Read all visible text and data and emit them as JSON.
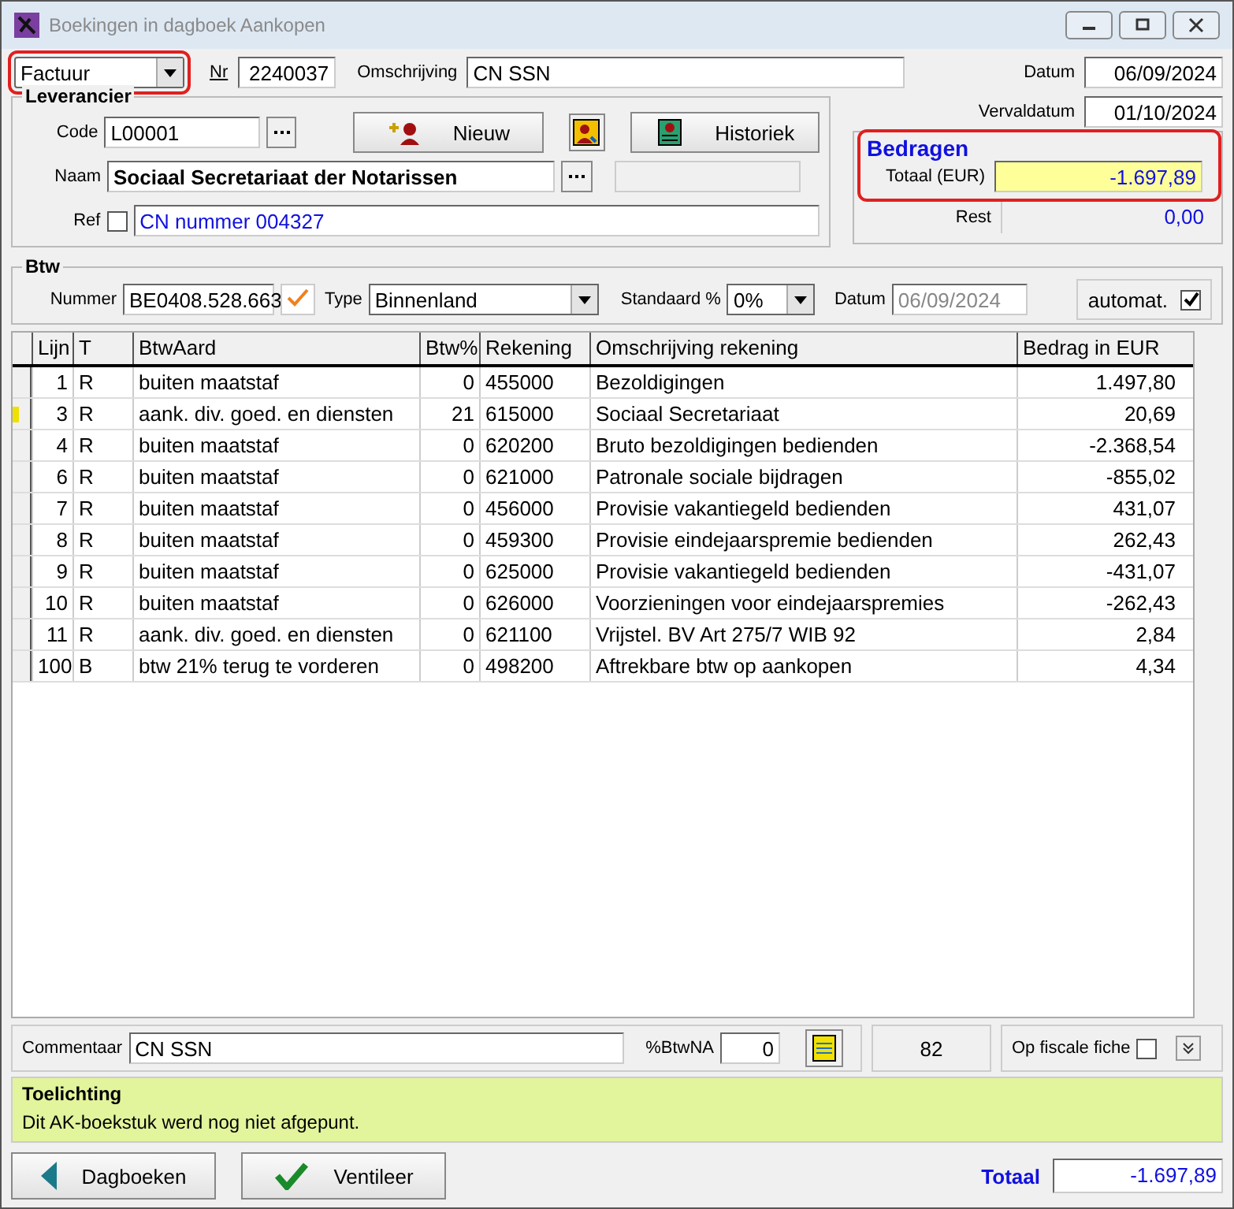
{
  "window": {
    "title": "Boekingen in dagboek Aankopen"
  },
  "header": {
    "doc_type": {
      "value": "Factuur",
      "highlighted": true
    },
    "nr_label": "Nr",
    "nr": "2240037",
    "omschrijving_label": "Omschrijving",
    "omschrijving": "CN SSN",
    "datum_label": "Datum",
    "datum": "06/09/2024",
    "vervaldatum_label": "Vervaldatum",
    "vervaldatum": "01/10/2024"
  },
  "leverancier": {
    "title": "Leverancier",
    "code_label": "Code",
    "code": "L00001",
    "nieuw_button": "Nieuw",
    "historiek_button": "Historiek",
    "naam_label": "Naam",
    "naam": "Sociaal Secretariaat der Notarissen",
    "ref_label": "Ref",
    "ref_checked": false,
    "ref": "CN nummer 004327"
  },
  "bedragen": {
    "title": "Bedragen",
    "totaal_label": "Totaal (EUR)",
    "totaal": "-1.697,89",
    "highlighted": true,
    "rest_label": "Rest",
    "rest": "0,00"
  },
  "btw": {
    "title": "Btw",
    "nummer_label": "Nummer",
    "nummer": "BE0408.528.663",
    "type_label": "Type",
    "type": "Binnenland",
    "standaard_label": "Standaard %",
    "standaard": "0%",
    "datum_label": "Datum",
    "datum": "06/09/2024",
    "automat_label": "automat.",
    "automat_checked": true
  },
  "table": {
    "columns": [
      "Lijn",
      "T",
      "BtwAard",
      "Btw%",
      "Rekening",
      "Omschrijving rekening",
      "Bedrag in EUR"
    ],
    "rows": [
      {
        "cells": [
          "1",
          "R",
          "buiten maatstaf",
          "0",
          "455000",
          "Bezoldigingen",
          "1.497,80"
        ],
        "selected": false
      },
      {
        "cells": [
          "3",
          "R",
          "aank. div. goed. en diensten",
          "21",
          "615000",
          "Sociaal Secretariaat",
          "20,69"
        ],
        "selected": true
      },
      {
        "cells": [
          "4",
          "R",
          "buiten maatstaf",
          "0",
          "620200",
          "Bruto bezoldigingen bedienden",
          "-2.368,54"
        ],
        "selected": false
      },
      {
        "cells": [
          "6",
          "R",
          "buiten maatstaf",
          "0",
          "621000",
          "Patronale sociale bijdragen",
          "-855,02"
        ],
        "selected": false
      },
      {
        "cells": [
          "7",
          "R",
          "buiten maatstaf",
          "0",
          "456000",
          "Provisie vakantiegeld bedienden",
          "431,07"
        ],
        "selected": false
      },
      {
        "cells": [
          "8",
          "R",
          "buiten maatstaf",
          "0",
          "459300",
          "Provisie eindejaarspremie bedienden",
          "262,43"
        ],
        "selected": false
      },
      {
        "cells": [
          "9",
          "R",
          "buiten maatstaf",
          "0",
          "625000",
          "Provisie vakantiegeld bedienden",
          "-431,07"
        ],
        "selected": false
      },
      {
        "cells": [
          "10",
          "R",
          "buiten maatstaf",
          "0",
          "626000",
          "Voorzieningen voor eindejaarspremies",
          "-262,43"
        ],
        "selected": false
      },
      {
        "cells": [
          "11",
          "R",
          "aank. div. goed. en diensten",
          "0",
          "621100",
          "Vrijstel. BV Art 275/7 WIB 92",
          "2,84"
        ],
        "selected": false
      },
      {
        "cells": [
          "100",
          "B",
          "btw 21% terug te vorderen",
          "0",
          "498200",
          "Aftrekbare btw op aankopen",
          "4,34"
        ],
        "selected": false
      }
    ]
  },
  "footer": {
    "commentaar_label": "Commentaar",
    "commentaar": "CN SSN",
    "btwna_label": "%BtwNA",
    "btwna": "0",
    "count": "82",
    "fiscale_label": "Op fiscale fiche",
    "fiscale_checked": false
  },
  "toelichting": {
    "title": "Toelichting",
    "text": "Dit AK-boekstuk werd nog niet afgepunt."
  },
  "buttons": {
    "dagboeken": "Dagboeken",
    "ventileer": "Ventileer",
    "totaal_label": "Totaal",
    "totaal": "-1.697,89"
  }
}
